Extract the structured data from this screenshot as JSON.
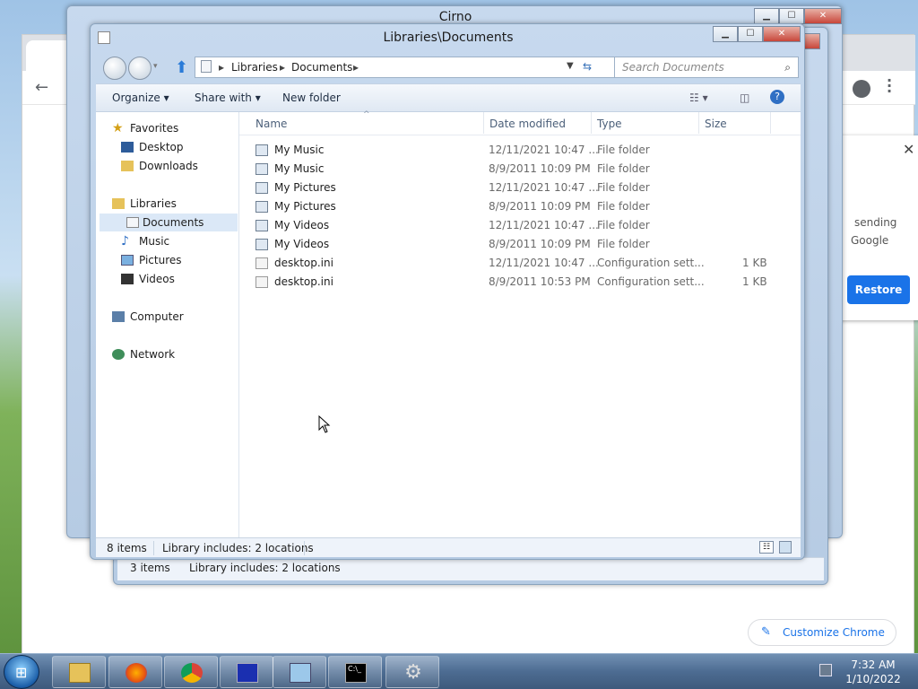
{
  "colors": {
    "accent": "#1a73e8",
    "taskbar": "#4d6c92",
    "explorer_frame": "#b6cbe3"
  },
  "bg_window_title": "Cirno",
  "chrome": {
    "restore_text_1": "sending",
    "restore_text_2": "Google",
    "restore_button": "Restore",
    "customize_button": "Customize Chrome"
  },
  "explorer": {
    "title": "Libraries\\Documents",
    "breadcrumb": [
      "Libraries",
      "Documents"
    ],
    "search_placeholder": "Search Documents",
    "commands": {
      "organize": "Organize",
      "share_with": "Share with",
      "new_folder": "New folder"
    },
    "nav": {
      "favorites": "Favorites",
      "desktop": "Desktop",
      "downloads": "Downloads",
      "libraries": "Libraries",
      "documents": "Documents",
      "music": "Music",
      "pictures": "Pictures",
      "videos": "Videos",
      "computer": "Computer",
      "network": "Network"
    },
    "columns": {
      "name": "Name",
      "date": "Date modified",
      "type": "Type",
      "size": "Size"
    },
    "files": [
      {
        "name": "My Music",
        "date": "12/11/2021 10:47 ...",
        "type": "File folder",
        "size": ""
      },
      {
        "name": "My Music",
        "date": "8/9/2011 10:09 PM",
        "type": "File folder",
        "size": ""
      },
      {
        "name": "My Pictures",
        "date": "12/11/2021 10:47 ...",
        "type": "File folder",
        "size": ""
      },
      {
        "name": "My Pictures",
        "date": "8/9/2011 10:09 PM",
        "type": "File folder",
        "size": ""
      },
      {
        "name": "My Videos",
        "date": "12/11/2021 10:47 ...",
        "type": "File folder",
        "size": ""
      },
      {
        "name": "My Videos",
        "date": "8/9/2011 10:09 PM",
        "type": "File folder",
        "size": ""
      },
      {
        "name": "desktop.ini",
        "date": "12/11/2021 10:47 ...",
        "type": "Configuration sett...",
        "size": "1 KB"
      },
      {
        "name": "desktop.ini",
        "date": "8/9/2011 10:53 PM",
        "type": "Configuration sett...",
        "size": "1 KB"
      }
    ],
    "status": {
      "count": "8 items",
      "library": "Library includes: 2 locations"
    }
  },
  "bg_explorer_status": {
    "count": "3 items",
    "library": "Library includes: 2 locations"
  },
  "bg_chrome_status_partial": "3",
  "taskbar": {
    "time": "7:32 AM",
    "date": "1/10/2022",
    "apps": [
      "file-explorer-icon",
      "firefox-icon",
      "chrome-icon",
      "blue-app-icon",
      "control-panel-icon",
      "command-prompt-icon",
      "settings-gear-icon"
    ]
  }
}
